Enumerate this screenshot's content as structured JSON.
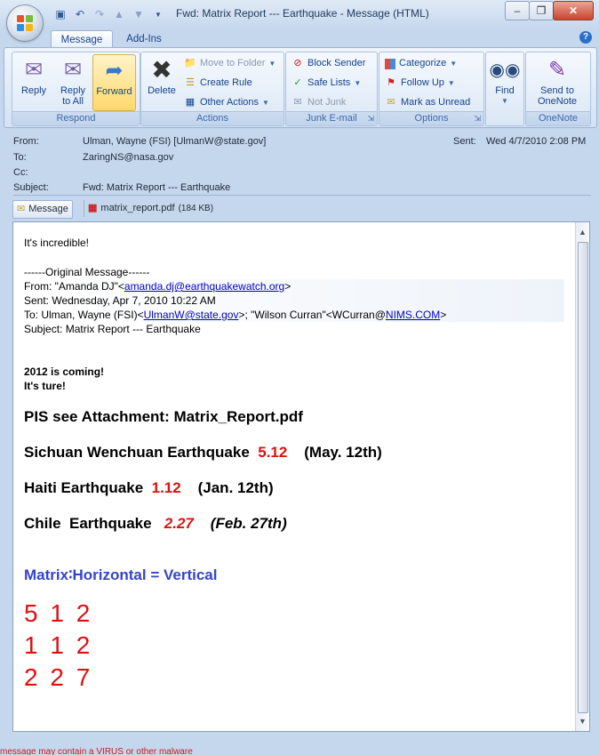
{
  "window": {
    "title": "Fwd: Matrix Report --- Earthquake - Message (HTML)"
  },
  "ribbon": {
    "tabs": [
      "Message",
      "Add-Ins"
    ],
    "respond": {
      "label": "Respond",
      "reply": "Reply",
      "reply_all_1": "Reply",
      "reply_all_2": "to All",
      "forward": "Forward"
    },
    "actions": {
      "label": "Actions",
      "delete": "Delete",
      "move_to_folder": "Move to Folder",
      "create_rule": "Create Rule",
      "other_actions": "Other Actions"
    },
    "junk": {
      "label": "Junk E-mail",
      "block_sender": "Block Sender",
      "safe_lists": "Safe Lists",
      "not_junk": "Not Junk"
    },
    "options": {
      "label": "Options",
      "categorize": "Categorize",
      "follow_up": "Follow Up",
      "mark_unread": "Mark as Unread"
    },
    "find": {
      "label": "Find",
      "find": "Find"
    },
    "onenote": {
      "label": "OneNote",
      "send_1": "Send to",
      "send_2": "OneNote"
    }
  },
  "header": {
    "from_label": "From:",
    "from_value": "Ulman, Wayne (FSI) [UlmanW@state.gov]",
    "to_label": "To:",
    "to_value": "ZaringNS@nasa.gov",
    "cc_label": "Cc:",
    "cc_value": "",
    "subject_label": "Subject:",
    "subject_value": "Fwd: Matrix Report --- Earthquake",
    "sent_label": "Sent:",
    "sent_value": "Wed 4/7/2010 2:08 PM"
  },
  "attachments": {
    "message": "Message",
    "file_name": "matrix_report.pdf",
    "file_size": "(184 KB)"
  },
  "body": {
    "greeting": "It's incredible!",
    "orig_sep": "------Original Message------",
    "from_prefix": "From: \"Amanda DJ\"<",
    "from_link": "amanda.dj@earthquakewatch.org",
    "from_suffix": ">",
    "sent_line": "Sent: Wednesday, Apr 7, 2010 10:22 AM",
    "to_prefix": "To: Ulman, Wayne (FSI)<",
    "to_link1": "UlmanW@state.gov",
    "to_mid": ">; \"Wilson Curran\"<WCurran@",
    "to_link2": "NIMS.COM",
    "to_suffix": ">",
    "subject_line": "Subject: Matrix Report --- Earthquake",
    "line_2012": "2012 is coming!",
    "line_ture": "It's ture!",
    "pis_line": "PIS see Attachment: Matrix_Report.pdf",
    "sichuan": {
      "name": "Sichuan Wenchuan Earthquake",
      "num": "5.12",
      "date": "(May. 12th)"
    },
    "haiti": {
      "name": "Haiti Earthquake",
      "num": "1.12",
      "date": "(Jan. 12th)"
    },
    "chile": {
      "name": "Chile  Earthquake",
      "num": "2.27",
      "date": "(Feb. 27th)"
    },
    "matrix_line": "Matrix∶Horizontal = Vertical",
    "matrix_rows": [
      "5 1 2",
      "1 1 2",
      "2 2 7"
    ]
  },
  "status": {
    "text": "message may contain a VIRUS or other malware"
  }
}
